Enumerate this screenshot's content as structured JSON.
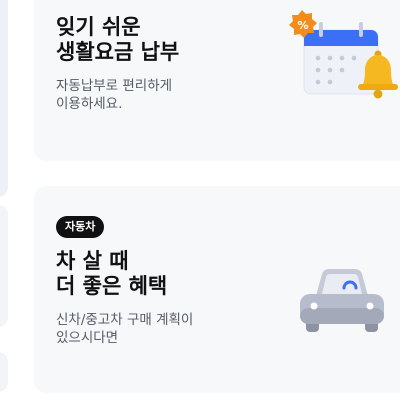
{
  "cards": [
    {
      "badge": "",
      "title_line1": "잊기 쉬운",
      "title_line2": "생활요금 납부",
      "desc_line1": "자동납부로 편리하게",
      "desc_line2": "이용하세요.",
      "icon": "calendar-bell-illustration",
      "percent_symbol": "%"
    },
    {
      "badge": "자동차",
      "title_line1": "차 살 때",
      "title_line2": "더 좋은 혜택",
      "desc_line1": "신차/중고차 구매 계획이",
      "desc_line2": "있으시다면",
      "icon": "car-illustration"
    }
  ],
  "colors": {
    "card_bg": "#f7f8fa",
    "badge_bg": "#111111",
    "title": "#111111",
    "desc": "#555b66",
    "calendar_header": "#3b6ff5",
    "bell": "#f5b820",
    "percent_badge": "#f28c1d",
    "car_body": "#b6bccb"
  }
}
